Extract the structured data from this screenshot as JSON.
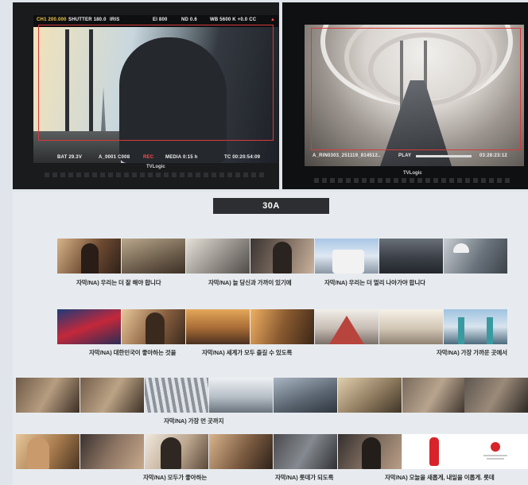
{
  "left_monitor": {
    "osd_top": [
      "CH1 200.000",
      "SHUTTER 180.0",
      "IRIS",
      "EI 800",
      "ND 0.6",
      "WB 5600 K +0.0 CC"
    ],
    "osd_bottom": [
      "BAT 29.3V",
      "A_0001 C008",
      "REC",
      "MEDIA 0:15 h",
      "TC 00:20:54:09"
    ],
    "brand": "TVLogic"
  },
  "right_monitor": {
    "osd_bottom": [
      "A_RIN0303_251119_814512..",
      "PLAY",
      "03:28:23:12"
    ],
    "brand": "TVLogic"
  },
  "storyboard": {
    "title": "30A",
    "captions": {
      "r1a": "자막/NA) 우리는 더 잘 해야 합니다",
      "r1b": "자막/NA) 늘 당신과 가까이 있기에",
      "r1c": "자막/NA) 우리는 더 멀리 나아가야 합니다",
      "r2a": "자막/NA) 대한민국이 좋아하는 것을",
      "r2b": "자막/NA) 세계가 모두 즐길 수 있도록",
      "r2c": "자막/NA) 가장 가까운 곳에서",
      "r3a": "자막/NA) 가장 먼 곳까지",
      "r4a": "자막/NA) 모두가 좋아하는",
      "r4b": "자막/NA) 롯데가 되도록",
      "r4c": "자막/NA) 오늘을 새롭게, 내일을 이롭게. 롯데"
    },
    "colors": {
      "title_bg": "#2d2e31",
      "page_bg": "#e7ebef",
      "logo_red": "#d8232a"
    }
  }
}
